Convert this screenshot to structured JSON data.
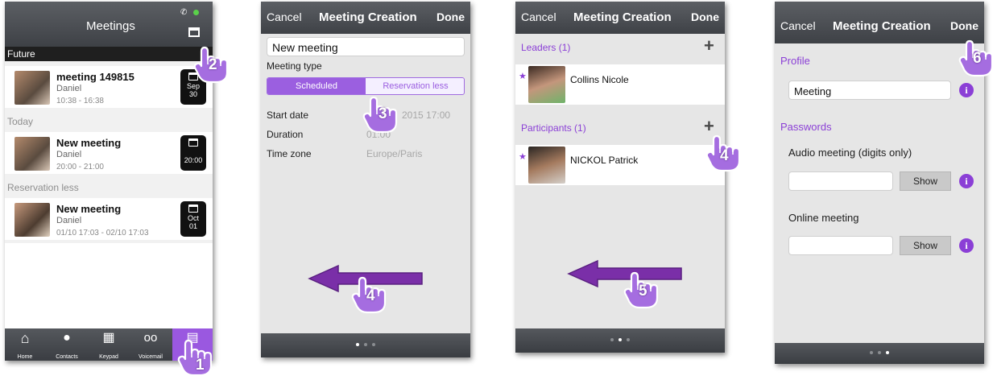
{
  "screen1": {
    "title": "Meetings",
    "sections": [
      "Future",
      "Today",
      "Reservation less"
    ],
    "meetings": [
      {
        "title": "meeting 149815",
        "owner": "Daniel",
        "time": "10:38 - 16:38",
        "badge_top": "Sep",
        "badge_bottom": "30"
      },
      {
        "title": "New meeting",
        "owner": "Daniel",
        "time": "20:00 - 21:00",
        "badge_top": "",
        "badge_bottom": "20:00"
      },
      {
        "title": "New meeting",
        "owner": "Daniel",
        "time": "01/10 17:03 - 02/10 17:03",
        "badge_top": "Oct",
        "badge_bottom": "01"
      }
    ],
    "tabs": [
      "Home",
      "Contacts",
      "Keypad",
      "Voicemail",
      "Me"
    ]
  },
  "screen2": {
    "cancel": "Cancel",
    "title": "Meeting Creation",
    "done": "Done",
    "name_value": "New meeting",
    "type_label": "Meeting type",
    "type_scheduled": "Scheduled",
    "type_reservation": "Reservation less",
    "start_label": "Start date",
    "start_value": "2015 17:00",
    "duration_label": "Duration",
    "duration_value": "01:00",
    "timezone_label": "Time zone",
    "timezone_value": "Europe/Paris"
  },
  "screen3": {
    "cancel": "Cancel",
    "title": "Meeting Creation",
    "done": "Done",
    "leaders_label": "Leaders (1)",
    "leader_name": "Collins Nicole",
    "participants_label": "Participants (1)",
    "participant_name": "NICKOL Patrick"
  },
  "screen4": {
    "cancel": "Cancel",
    "title": "Meeting Creation",
    "done": "Done",
    "profile_label": "Profile",
    "profile_value": "Meeting",
    "passwords_label": "Passwords",
    "audio_label": "Audio meeting (digits only)",
    "online_label": "Online meeting",
    "show_label": "Show"
  },
  "steps": [
    "1",
    "2",
    "3",
    "4",
    "4",
    "5",
    "6"
  ],
  "colors": {
    "accent": "#8b3fd6",
    "bar": "#45484d",
    "bg": "#e6e6e6"
  }
}
